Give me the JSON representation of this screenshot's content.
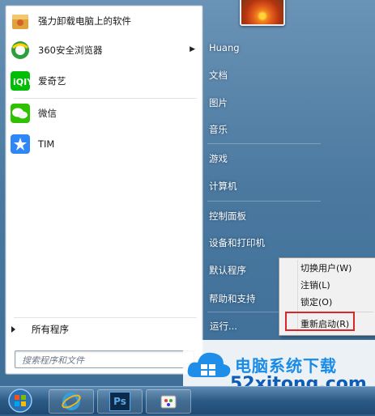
{
  "left_panel": {
    "pinned_apps": [
      {
        "label": "强力卸载电脑上的软件",
        "icon": "uninstaller-box-icon",
        "has_submenu": false
      },
      {
        "label": "360安全浏览器",
        "icon": "360-browser-icon",
        "has_submenu": true
      },
      {
        "label": "爱奇艺",
        "icon": "iqiyi-icon",
        "has_submenu": false
      }
    ],
    "recent_apps": [
      {
        "label": "微信",
        "icon": "wechat-icon"
      },
      {
        "label": "TIM",
        "icon": "tim-icon"
      }
    ],
    "all_programs": "所有程序",
    "search_placeholder": "搜索程序和文件"
  },
  "right_panel": {
    "user": "Huang",
    "items": [
      "文档",
      "图片",
      "音乐",
      "游戏",
      "计算机",
      "控制面板",
      "设备和打印机",
      "默认程序",
      "帮助和支持"
    ],
    "run": "运行..."
  },
  "context_menu": {
    "items": [
      "切换用户(W)",
      "注销(L)",
      "锁定(O)",
      "重新启动(R)"
    ],
    "highlighted": "重新启动(R)",
    "highlight_color": "#d9262a"
  },
  "taskbar": {
    "items": [
      "start-orb-icon",
      "ie-icon",
      "photoshop-icon",
      "paint-icon"
    ],
    "ps_label": "Ps"
  },
  "watermark": {
    "line1": "电脑系统下载",
    "line2": "52xitong.com"
  },
  "colors": {
    "frame": "#4a789f",
    "accent_blue": "#1a8be6"
  }
}
